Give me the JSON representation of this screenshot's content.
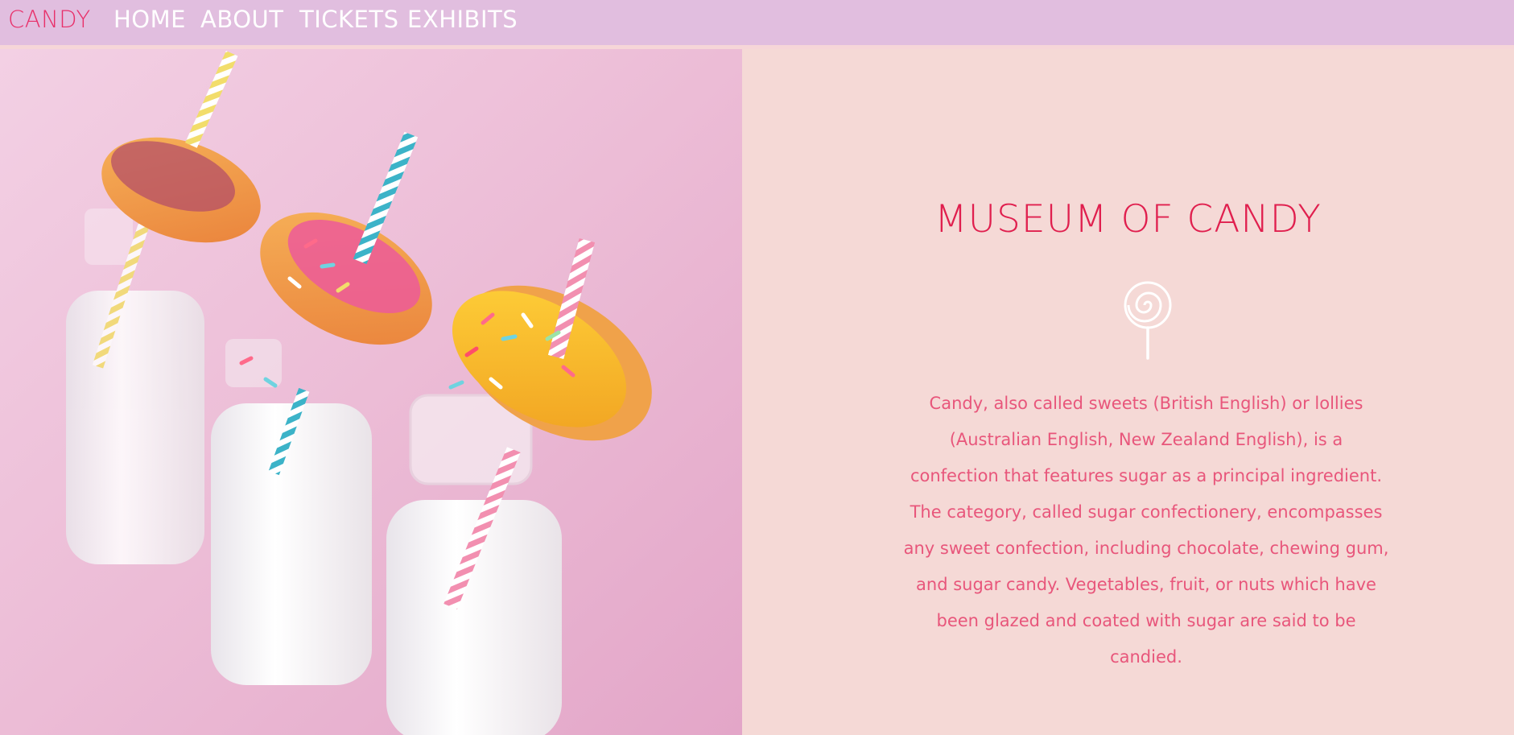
{
  "nav": {
    "brand": "CANDY",
    "links": [
      "HOME",
      "ABOUT",
      "TICKETS",
      "EXHIBITS"
    ]
  },
  "hero": {
    "image_alt": "Milk bottles with striped straws topped with sprinkled donuts on a pink background"
  },
  "main": {
    "title": "MUSEUM OF CANDY",
    "icon": "lollipop-icon",
    "description": "Candy, also called sweets (British English) or lollies (Australian English, New Zealand English), is a confection that features sugar as a principal ingredient. The category, called sugar confectionery, encompasses any sweet confection, including chocolate, chewing gum, and sugar candy. Vegetables, fruit, or nuts which have been glazed and coated with sugar are said to be candied."
  },
  "colors": {
    "nav_bg": "#e1bedf",
    "brand": "#e8306a",
    "panel_bg": "#f5d9d6",
    "title": "#e01f4e",
    "text": "#e8567b"
  }
}
